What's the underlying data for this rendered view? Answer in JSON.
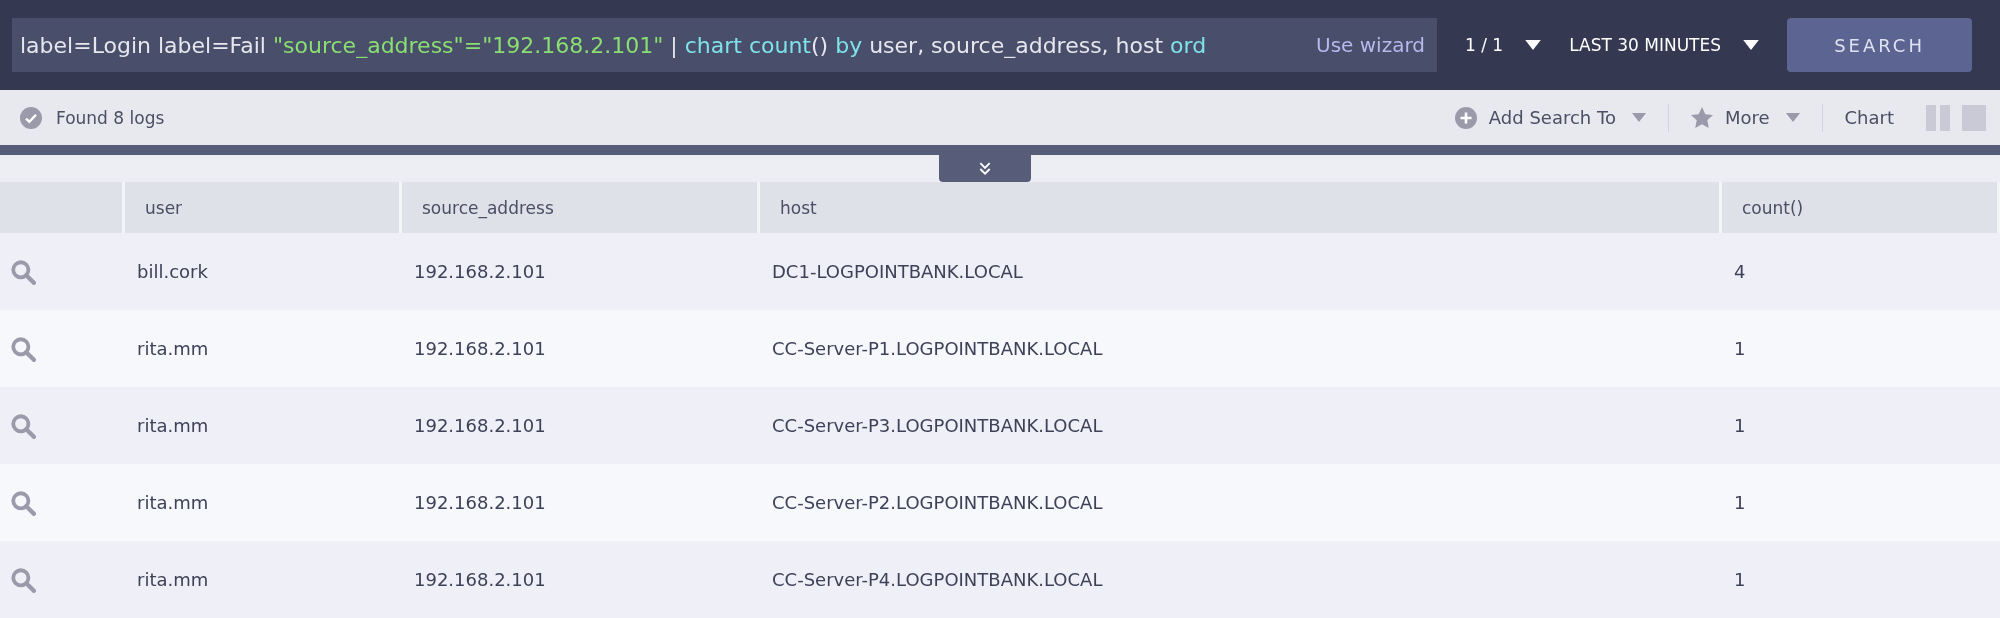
{
  "search_bar": {
    "query": [
      {
        "kind": "plain",
        "text": "label=Login label=Fail "
      },
      {
        "kind": "string",
        "text": "\"source_address\"=\"192.168.2.101\""
      },
      {
        "kind": "plain",
        "text": " | "
      },
      {
        "kind": "keyword",
        "text": "chart count"
      },
      {
        "kind": "plain",
        "text": "() "
      },
      {
        "kind": "keyword",
        "text": "by"
      },
      {
        "kind": "plain",
        "text": " user, source_address, host "
      },
      {
        "kind": "keyword",
        "text": "ord"
      }
    ],
    "wizard_link": "Use wizard",
    "page": "1 / 1",
    "time_range": "LAST 30 MINUTES",
    "search_button": "SEARCH"
  },
  "toolbar": {
    "status": "Found 8 logs",
    "add_search": "Add Search To",
    "more": "More",
    "chart": "Chart"
  },
  "table": {
    "columns": [
      "user",
      "source_address",
      "host",
      "count()"
    ],
    "rows": [
      [
        "bill.cork",
        "192.168.2.101",
        "DC1-LOGPOINTBANK.LOCAL",
        "4"
      ],
      [
        "rita.mm",
        "192.168.2.101",
        "CC-Server-P1.LOGPOINTBANK.LOCAL",
        "1"
      ],
      [
        "rita.mm",
        "192.168.2.101",
        "CC-Server-P3.LOGPOINTBANK.LOCAL",
        "1"
      ],
      [
        "rita.mm",
        "192.168.2.101",
        "CC-Server-P2.LOGPOINTBANK.LOCAL",
        "1"
      ],
      [
        "rita.mm",
        "192.168.2.101",
        "CC-Server-P4.LOGPOINTBANK.LOCAL",
        "1"
      ]
    ]
  }
}
